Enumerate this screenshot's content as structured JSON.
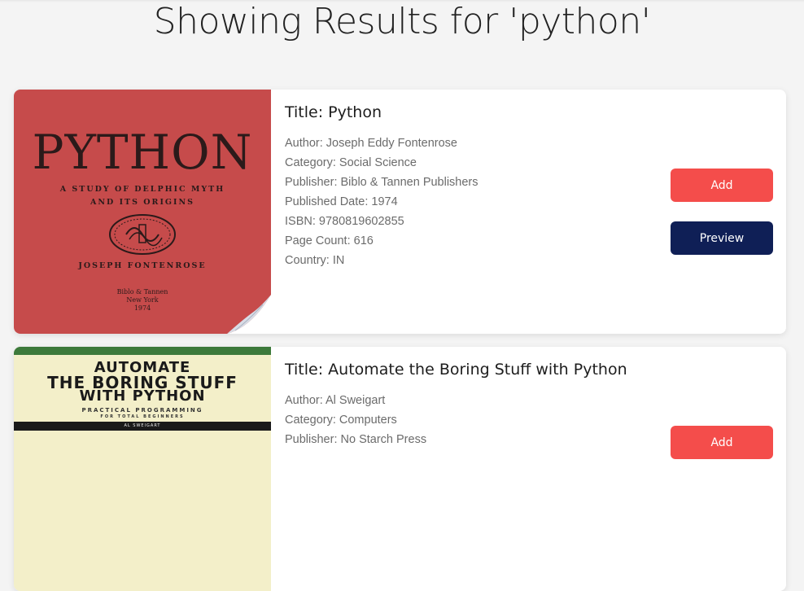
{
  "page": {
    "heading": "Showing Results for 'python'"
  },
  "results": [
    {
      "title_line": "Title: Python",
      "author_line": "Author: Joseph Eddy Fontenrose",
      "category_line": "Category: Social Science",
      "publisher_line": "Publisher: Biblo & Tannen Publishers",
      "published_date_line": "Published Date: 1974",
      "isbn_line": "ISBN: 9780819602855",
      "page_count_line": "Page Count: 616",
      "country_line": "Country: IN",
      "add_label": "Add",
      "preview_label": "Preview",
      "cover": {
        "title": "PYTHON",
        "subtitle_1": "A STUDY OF DELPHIC MYTH",
        "subtitle_2": "AND ITS ORIGINS",
        "author": "JOSEPH FONTENROSE",
        "publisher": "Biblo & Tannen",
        "city": "New York",
        "year": "1974",
        "color": "#c64b4b"
      }
    },
    {
      "title_line": "Title: Automate the Boring Stuff with Python",
      "author_line": "Author: Al Sweigart",
      "category_line": "Category: Computers",
      "publisher_line": "Publisher: No Starch Press",
      "add_label": "Add",
      "cover": {
        "line1": "AUTOMATE",
        "line2": "THE BORING STUFF",
        "line3": "WITH PYTHON",
        "small1": "PRACTICAL PROGRAMMING",
        "small2": "FOR TOTAL BEGINNERS",
        "author_bar": "AL SWEIGART",
        "color": "#f3efc9",
        "band_color": "#3d7a3b"
      }
    }
  ],
  "colors": {
    "add_button": "#f44d4b",
    "preview_button": "#0f1f56",
    "background": "#f4f4f4"
  }
}
